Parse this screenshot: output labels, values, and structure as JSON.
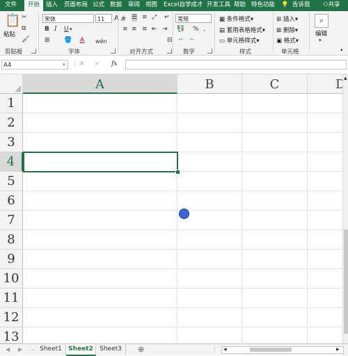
{
  "ribbon_tabs": [
    "文件",
    "开始",
    "插入",
    "页面布局",
    "公式",
    "数据",
    "审阅",
    "视图",
    "Excel自学成才",
    "开发工具",
    "帮助",
    "特色功能"
  ],
  "active_tab": "开始",
  "tell_me": "告诉我",
  "share": "共享",
  "clipboard": {
    "paste_label": "粘贴",
    "group_label": "剪贴板"
  },
  "font": {
    "name": "宋体",
    "size": "11",
    "group_label": "字体",
    "bold": "B",
    "italic": "I",
    "underline": "U",
    "grow": "A",
    "shrink": "A",
    "font_color": "A",
    "wen": "wén"
  },
  "alignment": {
    "group_label": "对齐方式"
  },
  "number": {
    "format": "常规",
    "group_label": "数字",
    "percent": "%",
    "comma": ","
  },
  "styles": {
    "conditional": "条件格式",
    "table": "套用表格格式",
    "cell": "单元格样式",
    "group_label": "样式"
  },
  "cells": {
    "insert": "插入",
    "delete": "删除",
    "format": "格式",
    "group_label": "单元格"
  },
  "editing": {
    "label": "编辑"
  },
  "formula_bar": {
    "name_box": "A4",
    "fx": "fx",
    "value": ""
  },
  "grid": {
    "columns": [
      "A",
      "B",
      "C",
      "D"
    ],
    "rows": [
      "1",
      "2",
      "3",
      "4",
      "5",
      "6",
      "7",
      "8",
      "9",
      "10",
      "11",
      "12",
      "13"
    ],
    "selected_cell": "A4"
  },
  "sheets": [
    "Sheet1",
    "Sheet2",
    "Sheet3"
  ],
  "active_sheet": "Sheet2",
  "add_sheet": "⊕",
  "colors": {
    "excel_green": "#217346",
    "cursor": "#3a64d8"
  }
}
